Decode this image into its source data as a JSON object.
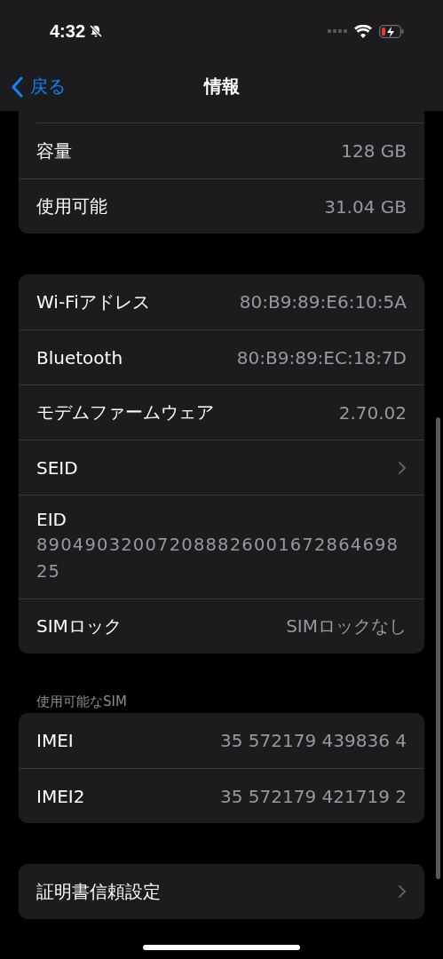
{
  "status_bar": {
    "time": "4:32",
    "silent": true,
    "charging": true
  },
  "nav": {
    "back": "戻る",
    "title": "情報"
  },
  "groups": [
    {
      "rows": [
        {
          "kind": "value",
          "label": "容量",
          "value": "128 GB"
        },
        {
          "kind": "value",
          "label": "使用可能",
          "value": "31.04 GB"
        }
      ]
    },
    {
      "rows": [
        {
          "kind": "value",
          "label": "Wi-Fiアドレス",
          "value": "80:B9:89:E6:10:5A"
        },
        {
          "kind": "value",
          "label": "Bluetooth",
          "value": "80:B9:89:EC:18:7D"
        },
        {
          "kind": "value",
          "label": "モデムファームウェア",
          "value": "2.70.02"
        },
        {
          "kind": "chevron",
          "label": "SEID"
        },
        {
          "kind": "stacked",
          "label": "EID",
          "value": "89049032007208882600167286469825"
        },
        {
          "kind": "value",
          "label": "SIMロック",
          "value": "SIMロックなし"
        }
      ]
    },
    {
      "header": "使用可能なSIM",
      "rows": [
        {
          "kind": "value",
          "label": "IMEI",
          "value": "35 572179 439836 4"
        },
        {
          "kind": "value",
          "label": "IMEI2",
          "value": "35 572179 421719 2"
        }
      ]
    },
    {
      "rows": [
        {
          "kind": "chevron",
          "label": "証明書信頼設定"
        }
      ]
    }
  ]
}
